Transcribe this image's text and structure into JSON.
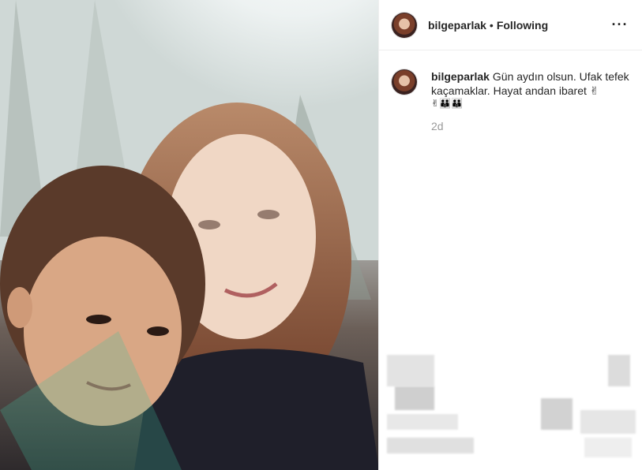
{
  "post": {
    "username": "bilgeparlak",
    "separator": "•",
    "follow_label": "Following",
    "more_icon": "more-horizontal-icon",
    "caption": {
      "username": "bilgeparlak",
      "text": "Gün aydın olsun. Ufak tefek kaçamaklar. Hayat andan ibaret ✌",
      "emoji_line": "✌👪👪"
    },
    "timestamp": "2d"
  }
}
